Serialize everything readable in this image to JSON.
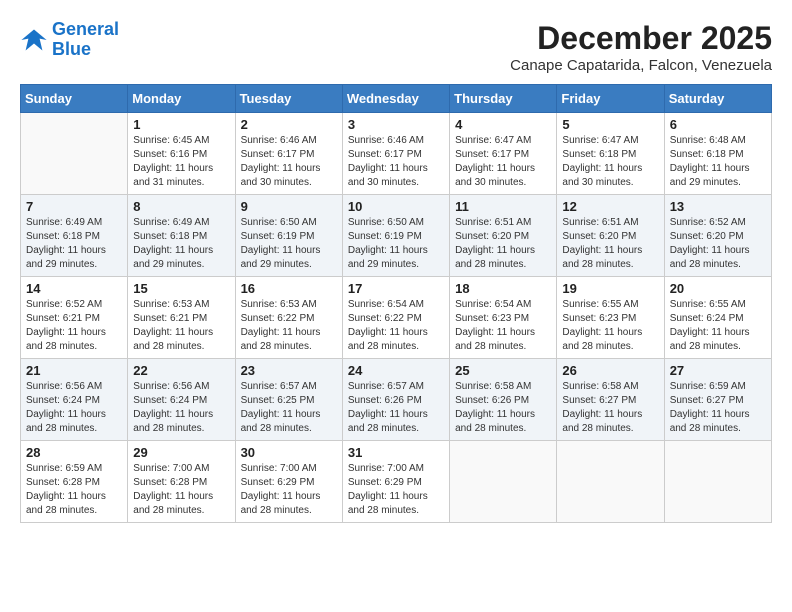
{
  "header": {
    "logo_line1": "General",
    "logo_line2": "Blue",
    "month": "December 2025",
    "location": "Canape Capatarida, Falcon, Venezuela"
  },
  "days_of_week": [
    "Sunday",
    "Monday",
    "Tuesday",
    "Wednesday",
    "Thursday",
    "Friday",
    "Saturday"
  ],
  "weeks": [
    [
      {
        "day": "",
        "info": ""
      },
      {
        "day": "1",
        "info": "Sunrise: 6:45 AM\nSunset: 6:16 PM\nDaylight: 11 hours\nand 31 minutes."
      },
      {
        "day": "2",
        "info": "Sunrise: 6:46 AM\nSunset: 6:17 PM\nDaylight: 11 hours\nand 30 minutes."
      },
      {
        "day": "3",
        "info": "Sunrise: 6:46 AM\nSunset: 6:17 PM\nDaylight: 11 hours\nand 30 minutes."
      },
      {
        "day": "4",
        "info": "Sunrise: 6:47 AM\nSunset: 6:17 PM\nDaylight: 11 hours\nand 30 minutes."
      },
      {
        "day": "5",
        "info": "Sunrise: 6:47 AM\nSunset: 6:18 PM\nDaylight: 11 hours\nand 30 minutes."
      },
      {
        "day": "6",
        "info": "Sunrise: 6:48 AM\nSunset: 6:18 PM\nDaylight: 11 hours\nand 29 minutes."
      }
    ],
    [
      {
        "day": "7",
        "info": "Sunrise: 6:49 AM\nSunset: 6:18 PM\nDaylight: 11 hours\nand 29 minutes."
      },
      {
        "day": "8",
        "info": "Sunrise: 6:49 AM\nSunset: 6:18 PM\nDaylight: 11 hours\nand 29 minutes."
      },
      {
        "day": "9",
        "info": "Sunrise: 6:50 AM\nSunset: 6:19 PM\nDaylight: 11 hours\nand 29 minutes."
      },
      {
        "day": "10",
        "info": "Sunrise: 6:50 AM\nSunset: 6:19 PM\nDaylight: 11 hours\nand 29 minutes."
      },
      {
        "day": "11",
        "info": "Sunrise: 6:51 AM\nSunset: 6:20 PM\nDaylight: 11 hours\nand 28 minutes."
      },
      {
        "day": "12",
        "info": "Sunrise: 6:51 AM\nSunset: 6:20 PM\nDaylight: 11 hours\nand 28 minutes."
      },
      {
        "day": "13",
        "info": "Sunrise: 6:52 AM\nSunset: 6:20 PM\nDaylight: 11 hours\nand 28 minutes."
      }
    ],
    [
      {
        "day": "14",
        "info": "Sunrise: 6:52 AM\nSunset: 6:21 PM\nDaylight: 11 hours\nand 28 minutes."
      },
      {
        "day": "15",
        "info": "Sunrise: 6:53 AM\nSunset: 6:21 PM\nDaylight: 11 hours\nand 28 minutes."
      },
      {
        "day": "16",
        "info": "Sunrise: 6:53 AM\nSunset: 6:22 PM\nDaylight: 11 hours\nand 28 minutes."
      },
      {
        "day": "17",
        "info": "Sunrise: 6:54 AM\nSunset: 6:22 PM\nDaylight: 11 hours\nand 28 minutes."
      },
      {
        "day": "18",
        "info": "Sunrise: 6:54 AM\nSunset: 6:23 PM\nDaylight: 11 hours\nand 28 minutes."
      },
      {
        "day": "19",
        "info": "Sunrise: 6:55 AM\nSunset: 6:23 PM\nDaylight: 11 hours\nand 28 minutes."
      },
      {
        "day": "20",
        "info": "Sunrise: 6:55 AM\nSunset: 6:24 PM\nDaylight: 11 hours\nand 28 minutes."
      }
    ],
    [
      {
        "day": "21",
        "info": "Sunrise: 6:56 AM\nSunset: 6:24 PM\nDaylight: 11 hours\nand 28 minutes."
      },
      {
        "day": "22",
        "info": "Sunrise: 6:56 AM\nSunset: 6:24 PM\nDaylight: 11 hours\nand 28 minutes."
      },
      {
        "day": "23",
        "info": "Sunrise: 6:57 AM\nSunset: 6:25 PM\nDaylight: 11 hours\nand 28 minutes."
      },
      {
        "day": "24",
        "info": "Sunrise: 6:57 AM\nSunset: 6:26 PM\nDaylight: 11 hours\nand 28 minutes."
      },
      {
        "day": "25",
        "info": "Sunrise: 6:58 AM\nSunset: 6:26 PM\nDaylight: 11 hours\nand 28 minutes."
      },
      {
        "day": "26",
        "info": "Sunrise: 6:58 AM\nSunset: 6:27 PM\nDaylight: 11 hours\nand 28 minutes."
      },
      {
        "day": "27",
        "info": "Sunrise: 6:59 AM\nSunset: 6:27 PM\nDaylight: 11 hours\nand 28 minutes."
      }
    ],
    [
      {
        "day": "28",
        "info": "Sunrise: 6:59 AM\nSunset: 6:28 PM\nDaylight: 11 hours\nand 28 minutes."
      },
      {
        "day": "29",
        "info": "Sunrise: 7:00 AM\nSunset: 6:28 PM\nDaylight: 11 hours\nand 28 minutes."
      },
      {
        "day": "30",
        "info": "Sunrise: 7:00 AM\nSunset: 6:29 PM\nDaylight: 11 hours\nand 28 minutes."
      },
      {
        "day": "31",
        "info": "Sunrise: 7:00 AM\nSunset: 6:29 PM\nDaylight: 11 hours\nand 28 minutes."
      },
      {
        "day": "",
        "info": ""
      },
      {
        "day": "",
        "info": ""
      },
      {
        "day": "",
        "info": ""
      }
    ]
  ]
}
